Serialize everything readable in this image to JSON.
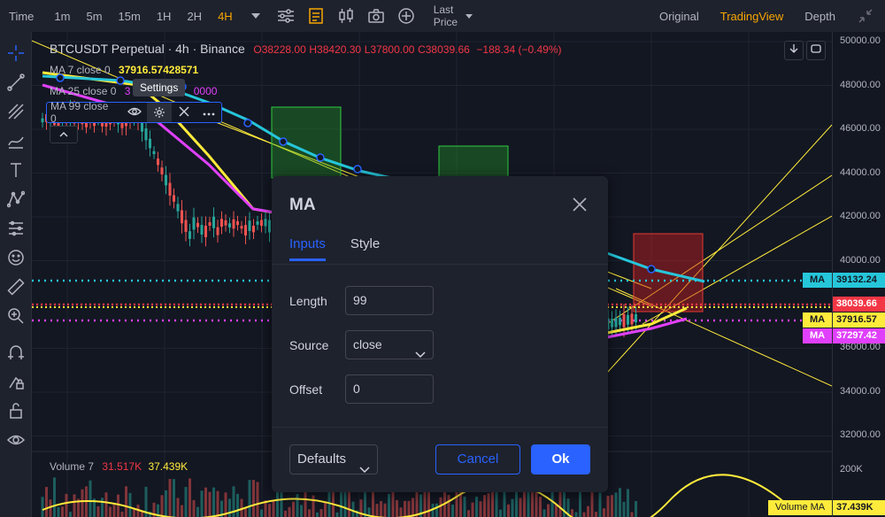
{
  "toolbar": {
    "time_label": "Time",
    "intervals": [
      "1m",
      "5m",
      "15m",
      "1H",
      "2H",
      "4H"
    ],
    "active_interval": "4H",
    "last_price_line1": "Last",
    "last_price_line2": "Price",
    "views": [
      "Original",
      "TradingView",
      "Depth"
    ],
    "active_view": "TradingView"
  },
  "legend": {
    "symbol": "BTCUSDT Perpetual · 4h · Binance",
    "open": "O38228.00",
    "high": "H38420.30",
    "low": "L37800.00",
    "close": "C38039.66",
    "change": "−188.34 (−0.49%)"
  },
  "indicators": {
    "ma7_label": "MA 7 close 0",
    "ma7_value": "37916.57428571",
    "ma25_label": "MA 25 close 0",
    "ma25_value_prefix": "3",
    "ma25_value_suffix": "0000",
    "ma99_label": "MA 99 close 0"
  },
  "tooltip": "Settings",
  "price_axis": {
    "labels": [
      "50000.00",
      "48000.00",
      "46000.00",
      "44000.00",
      "42000.00",
      "40000.00",
      "36000.00",
      "34000.00",
      "32000.00"
    ],
    "volume_label": "200K",
    "tag_ma99": "39132.24",
    "tag_last": "38039.66",
    "tag_ma7": "37916.57",
    "tag_ma25": "37297.42",
    "tag_vol": "37.439K",
    "ma_tag_text": "MA",
    "vol_ma_tag_text": "Volume MA"
  },
  "volume_legend": {
    "label": "Volume 7",
    "v1": "31.517K",
    "v2": "37.439K"
  },
  "dialog": {
    "title": "MA",
    "tabs": [
      "Inputs",
      "Style"
    ],
    "active_tab": "Inputs",
    "length_label": "Length",
    "length_value": "99",
    "source_label": "Source",
    "source_value": "close",
    "offset_label": "Offset",
    "offset_value": "0",
    "defaults_label": "Defaults",
    "cancel_label": "Cancel",
    "ok_label": "Ok"
  },
  "colors": {
    "accent": "#2962ff",
    "highlight": "#f7a600",
    "ma7": "#ffeb3b",
    "ma25": "#e040fb",
    "ma99": "#26c6da",
    "up": "#26a69a",
    "down": "#ef5350"
  }
}
